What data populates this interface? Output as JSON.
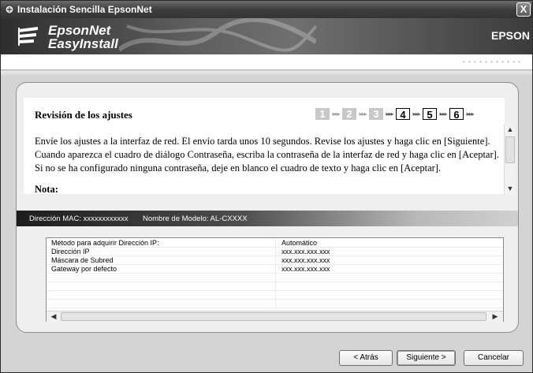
{
  "window": {
    "title": "Instalación Sencilla EpsonNet",
    "close_label": "X"
  },
  "banner": {
    "logo_line1": "EpsonNet",
    "logo_line2": "EasyInstall",
    "brand": "EPSON",
    "dots": "• • • • • • • • • • •"
  },
  "step": {
    "title": "Revisión de los ajustes",
    "numbers": [
      "1",
      "2",
      "3",
      "4",
      "5",
      "6"
    ],
    "arrow": "▸▸▸",
    "completed_count": 3
  },
  "description": {
    "paragraph": "Envíe los ajustes a la interfaz de red. El envío tarda unos 10 segundos. Revise los ajustes y haga clic en [Siguiente]. Cuando aparezca el cuadro de diálogo Contraseña, escriba la contraseña de la interfaz de red y haga clic en [Aceptar]. Si no se ha configurado ninguna contraseña, deje en blanco el cuadro de texto y haga clic en [Aceptar].",
    "note": "Nota:"
  },
  "device": {
    "mac": "Dirección MAC: xxxxxxxxxxxx",
    "model": "Nombre de Modelo: AL-CXXXX"
  },
  "settings_table": {
    "rows": [
      {
        "key": "Método para adquirir Dirección IP:",
        "value": "Automático"
      },
      {
        "key": "Dirección IP",
        "value": "xxx.xxx.xxx.xxx"
      },
      {
        "key": "Máscara de Subred",
        "value": "xxx.xxx.xxx.xxx"
      },
      {
        "key": "Gateway por defecto",
        "value": "xxx.xxx.xxx.xxx"
      },
      {
        "key": "",
        "value": ""
      },
      {
        "key": "",
        "value": ""
      },
      {
        "key": "",
        "value": ""
      },
      {
        "key": "",
        "value": ""
      }
    ]
  },
  "buttons": {
    "back": "< Atrás",
    "next": "Siguiente >",
    "cancel": "Cancelar"
  },
  "colors": {
    "step_done": "#c8c8c8",
    "accent_dark": "#3e3e3e"
  }
}
